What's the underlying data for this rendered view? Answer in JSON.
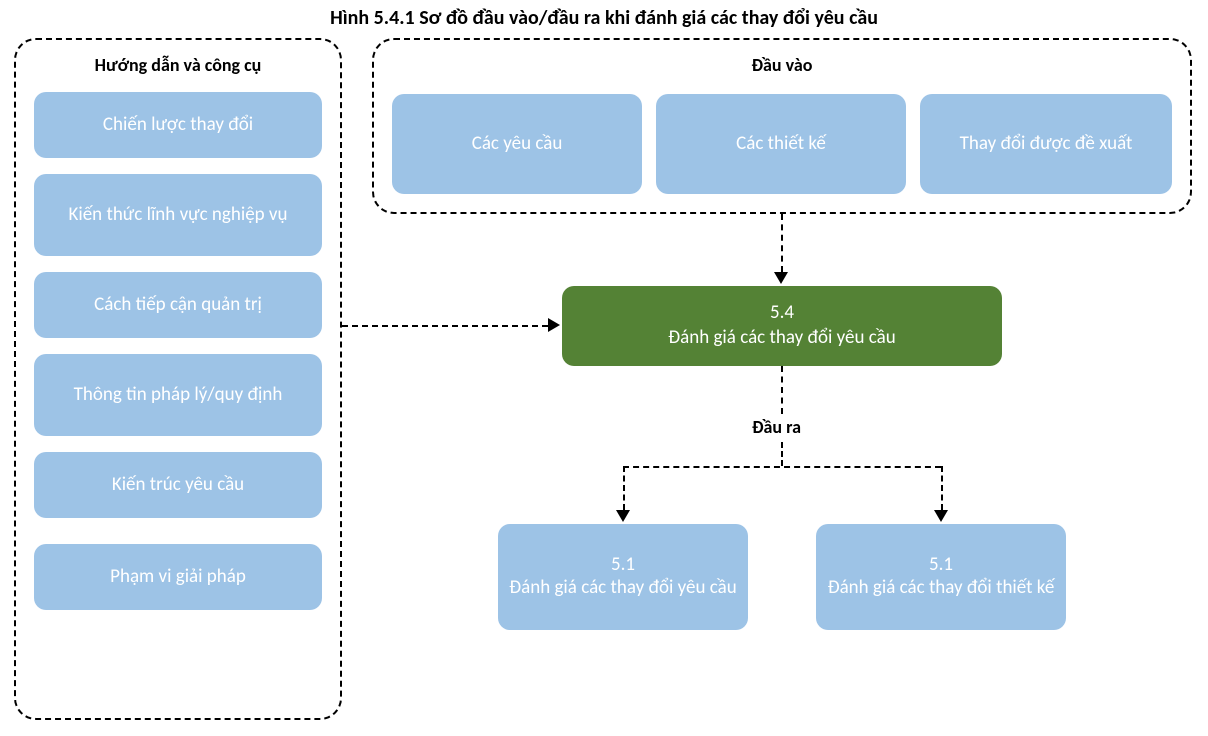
{
  "title": "Hình 5.4.1 Sơ đồ đầu vào/đầu ra khi đánh giá các thay đổi yêu cầu",
  "guides": {
    "heading": "Hướng dẫn và công cụ",
    "items": [
      "Chiến lược thay đổi",
      "Kiến thức lĩnh vực nghiệp vụ",
      "Cách tiếp cận quản trị",
      "Thông tin pháp lý/quy định",
      "Kiến trúc yêu cầu",
      "Phạm vi giải pháp"
    ]
  },
  "inputs": {
    "heading": "Đầu vào",
    "items": [
      "Các yêu cầu",
      "Các thiết kế",
      "Thay đổi được đề xuất"
    ]
  },
  "process": {
    "code": "5.4",
    "label": "Đánh giá các thay đổi yêu cầu"
  },
  "outputs": {
    "heading": "Đầu ra",
    "items": [
      {
        "code": "5.1",
        "label": "Đánh giá các thay đổi yêu cầu"
      },
      {
        "code": "5.1",
        "label": "Đánh giá các thay đổi thiết kế"
      }
    ]
  }
}
